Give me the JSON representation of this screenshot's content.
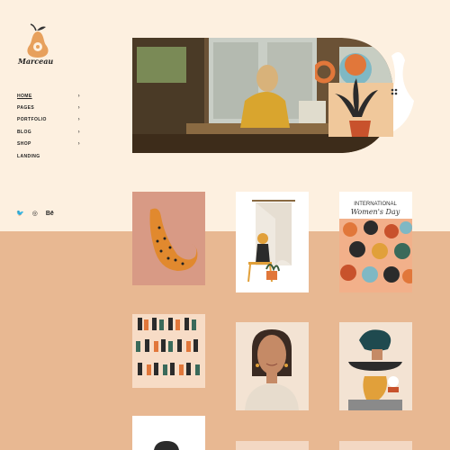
{
  "brand": {
    "name": "Marceau"
  },
  "nav": {
    "items": [
      {
        "label": "HOME",
        "chevron": "›",
        "active": true
      },
      {
        "label": "PAGES",
        "chevron": "›"
      },
      {
        "label": "PORTFOLIO",
        "chevron": "›"
      },
      {
        "label": "BLOG",
        "chevron": "›"
      },
      {
        "label": "SHOP",
        "chevron": "›"
      },
      {
        "label": "LANDING",
        "chevron": ""
      }
    ]
  },
  "social": {
    "twitter": "🐦",
    "dribbble": "◎",
    "behance": "Bē"
  },
  "gallery": {
    "womens_day_line1": "INTERNATIONAL",
    "womens_day_line2": "Women's Day"
  },
  "colors": {
    "page_top": "#fdf0e0",
    "page_bottom": "#e8b892",
    "accent_orange": "#e1773a",
    "accent_teal": "#7fb8c4"
  }
}
